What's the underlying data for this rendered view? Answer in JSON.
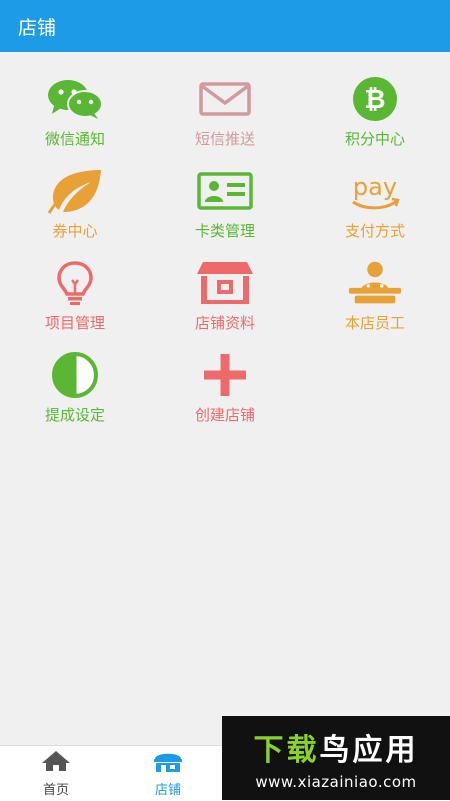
{
  "header": {
    "title": "店铺"
  },
  "colors": {
    "header_bg": "#1e9be6",
    "green": "#5ab734",
    "pink": "#d19a9d",
    "orange": "#e8a136",
    "red": "#ee6a6a",
    "nav_active": "#1e9be6"
  },
  "tiles": [
    {
      "label": "微信通知",
      "icon": "wechat-icon",
      "color": "#5ab734"
    },
    {
      "label": "短信推送",
      "icon": "envelope-icon",
      "color": "#d19a9d"
    },
    {
      "label": "积分中心",
      "icon": "bitcoin-icon",
      "color": "#5ab734"
    },
    {
      "label": "券中心",
      "icon": "leaf-icon",
      "color": "#e8a136"
    },
    {
      "label": "卡类管理",
      "icon": "id-card-icon",
      "color": "#5ab734"
    },
    {
      "label": "支付方式",
      "icon": "pay-icon",
      "color": "#e8a136"
    },
    {
      "label": "项目管理",
      "icon": "lightbulb-icon",
      "color": "#ee6a6a"
    },
    {
      "label": "店铺资料",
      "icon": "store-icon",
      "color": "#ee6a6a"
    },
    {
      "label": "本店员工",
      "icon": "staff-icon",
      "color": "#e8a136"
    },
    {
      "label": "提成设定",
      "icon": "half-circle-icon",
      "color": "#5ab734"
    },
    {
      "label": "创建店铺",
      "icon": "plus-icon",
      "color": "#ee6a6a"
    }
  ],
  "bottom_nav": [
    {
      "label": "首页",
      "icon": "home-icon",
      "active": false
    },
    {
      "label": "店铺",
      "icon": "shop-icon",
      "active": true
    }
  ],
  "watermark": {
    "title_part1": "下载",
    "title_part2": "鸟应用",
    "url": "www.xiazainiao.com"
  }
}
